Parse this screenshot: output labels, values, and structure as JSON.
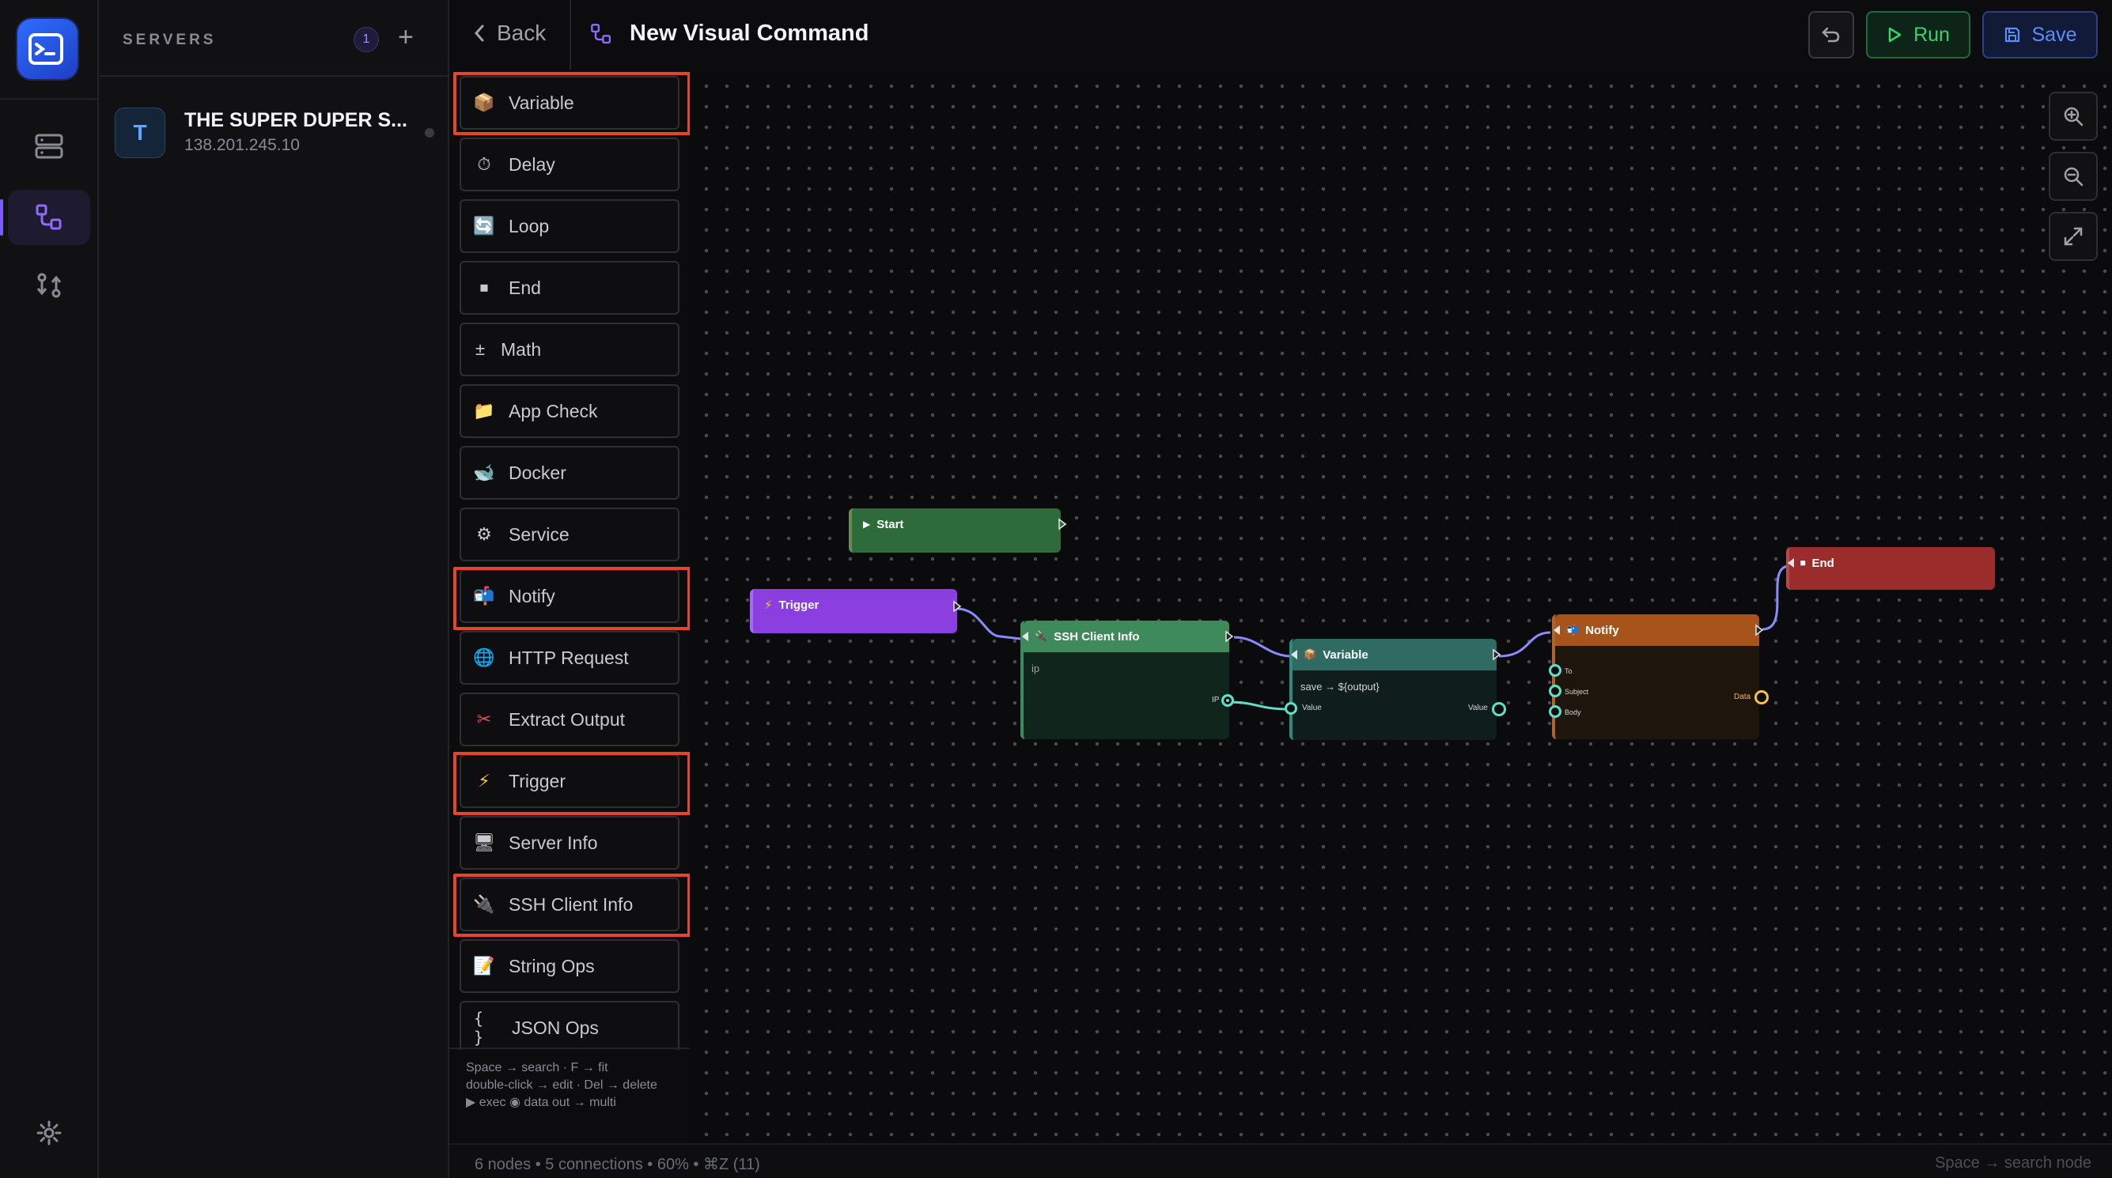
{
  "rail": {
    "items": [
      "servers-icon",
      "visual-commands-icon",
      "sync-icon"
    ],
    "settings": "gear-icon"
  },
  "servers": {
    "title": "SERVERS",
    "count": "1",
    "add": "+",
    "list": [
      {
        "initial": "T",
        "name": "THE SUPER DUPER S...",
        "ip": "138.201.245.10"
      }
    ]
  },
  "header": {
    "back_label": "Back",
    "title": "New Visual Command",
    "run_label": "Run",
    "save_label": "Save"
  },
  "palette": {
    "items": [
      {
        "label": "Variable",
        "icon": "📦"
      },
      {
        "label": "Delay",
        "icon": "⏱"
      },
      {
        "label": "Loop",
        "icon": "🔄"
      },
      {
        "label": "End",
        "icon": "⏹"
      },
      {
        "label": "Math",
        "icon": "±"
      },
      {
        "label": "App Check",
        "icon": "📁"
      },
      {
        "label": "Docker",
        "icon": "🐋"
      },
      {
        "label": "Service",
        "icon": "⚙"
      },
      {
        "label": "Notify",
        "icon": "📬"
      },
      {
        "label": "HTTP Request",
        "icon": "🌐"
      },
      {
        "label": "Extract Output",
        "icon": "✂"
      },
      {
        "label": "Trigger",
        "icon": "⚡"
      },
      {
        "label": "Server Info",
        "icon": "🖥"
      },
      {
        "label": "SSH Client Info",
        "icon": "🔌"
      },
      {
        "label": "String Ops",
        "icon": "📝"
      },
      {
        "label": "JSON Ops",
        "icon": "{ }"
      }
    ],
    "tips": {
      "line1": "Space → search  ·  F → fit",
      "line2": "double-click → edit  ·  Del → delete",
      "line3": "▶ exec  ◉ data  out → multi"
    }
  },
  "nodes": {
    "start": {
      "title": "Start",
      "icon": "▶",
      "color": "#2e6b3a"
    },
    "trigger": {
      "title": "Trigger",
      "icon": "⚡",
      "color": "#8b3fe0"
    },
    "ssh": {
      "title": "SSH Client Info",
      "icon": "🔌",
      "color": "#3f8a5a",
      "field": "ip",
      "out_label": "IP"
    },
    "variable": {
      "title": "Variable",
      "icon": "📦",
      "color": "#2f6b62",
      "field": "save → ${output}",
      "in_label": "Value",
      "out_label": "Value"
    },
    "notify": {
      "title": "Notify",
      "icon": "📬",
      "color": "#a6541c",
      "inputs": [
        "To",
        "Subject",
        "Body"
      ],
      "out_label": "Data"
    },
    "end": {
      "title": "End",
      "icon": "⏹",
      "color": "#9a2c2c"
    }
  },
  "status": {
    "left": "6 nodes  •  5 connections  •  60%  •  ⌘Z (11)",
    "right": "Space → search node"
  }
}
